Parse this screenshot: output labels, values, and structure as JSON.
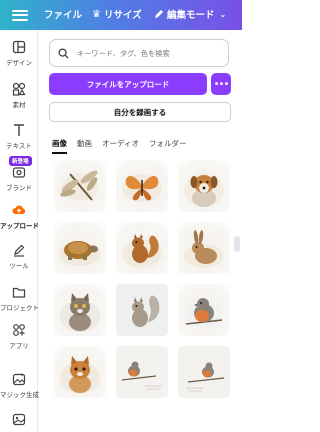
{
  "topbar": {
    "file_label": "ファイル",
    "resize_label": "リサイズ",
    "edit_mode_label": "編集モード"
  },
  "sidebar": {
    "items": [
      {
        "label": "デザイン",
        "icon": "layout-icon"
      },
      {
        "label": "素材",
        "icon": "elements-icon"
      },
      {
        "label": "テキスト",
        "icon": "text-icon"
      },
      {
        "label": "ブランド",
        "icon": "brand-icon",
        "badge": "新登場"
      },
      {
        "label": "アップロード",
        "icon": "upload-cloud-icon"
      },
      {
        "label": "ツール",
        "icon": "draw-icon"
      },
      {
        "label": "プロジェクト",
        "icon": "folder-icon"
      },
      {
        "label": "アプリ",
        "icon": "apps-icon"
      },
      {
        "label": "マジック生成",
        "icon": "magic-media-icon"
      },
      {
        "label": "",
        "icon": "image-icon"
      }
    ]
  },
  "panel": {
    "search_placeholder": "キーワード、タグ、色を検索",
    "upload_button": "ファイルをアップロード",
    "more_button": "•••",
    "record_button": "自分を録画する",
    "tabs": [
      "画像",
      "動画",
      "オーディオ",
      "フォルダー"
    ],
    "active_tab": "画像"
  },
  "gallery": {
    "items": [
      "dragonfly",
      "butterfly",
      "dog",
      "turtle",
      "squirrel",
      "rabbit",
      "cat",
      "squirrel",
      "robin",
      "cat",
      "robin",
      "robin"
    ]
  },
  "colors": {
    "accent": "#8b3dff",
    "topbar_gradient_start": "#2fb3c9",
    "topbar_gradient_end": "#7a4fe8",
    "upload_icon": "#ff6a00"
  }
}
